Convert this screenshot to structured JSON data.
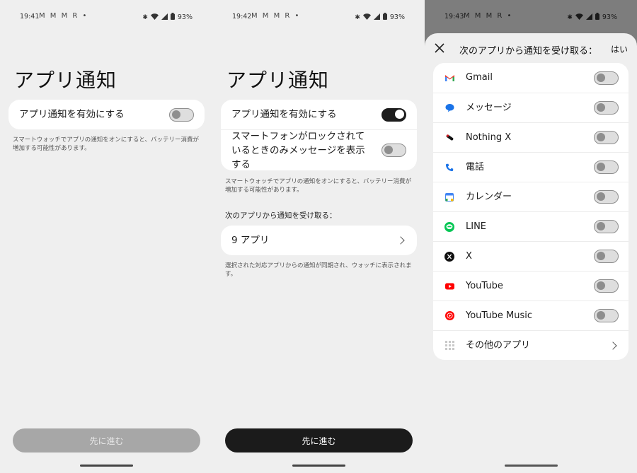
{
  "screen1": {
    "status": {
      "time": "19:41",
      "notifs": "M M M R •",
      "battery": "93%"
    },
    "title": "アプリ通知",
    "toggle_label": "アプリ通知を有効にする",
    "toggle_on": false,
    "note": "スマートウォッチでアプリの通知をオンにすると、バッテリー消費が増加する可能性があります。",
    "cta": "先に進む"
  },
  "screen2": {
    "status": {
      "time": "19:42",
      "notifs": "M M M R •",
      "battery": "93%"
    },
    "title": "アプリ通知",
    "toggle_label": "アプリ通知を有効にする",
    "toggle_on": true,
    "lock_label": "スマートフォンがロックされているときのみメッセージを表示する",
    "lock_on": false,
    "note": "スマートウォッチでアプリの通知をオンにすると、バッテリー消費が増加する可能性があります。",
    "apps_heading": "次のアプリから通知を受け取る：",
    "apps_count": "9 アプリ",
    "apps_note": "選択された対応アプリからの通知が同期され、ウォッチに表示されます。",
    "cta": "先に進む"
  },
  "screen3": {
    "status": {
      "time": "19:43",
      "notifs": "M M M R •",
      "battery": "93%"
    },
    "sheet_title": "次のアプリから通知を受け取る：",
    "confirm": "はい",
    "apps": [
      {
        "name": "Gmail",
        "icon": "gmail-icon",
        "on": false
      },
      {
        "name": "メッセージ",
        "icon": "messages-icon",
        "on": false
      },
      {
        "name": "Nothing X",
        "icon": "nothing-x-icon",
        "on": false
      },
      {
        "name": "電話",
        "icon": "phone-icon",
        "on": false
      },
      {
        "name": "カレンダー",
        "icon": "calendar-icon",
        "on": false
      },
      {
        "name": "LINE",
        "icon": "line-icon",
        "on": false
      },
      {
        "name": "X",
        "icon": "x-icon",
        "on": false
      },
      {
        "name": "YouTube",
        "icon": "youtube-icon",
        "on": false
      },
      {
        "name": "YouTube Music",
        "icon": "youtube-music-icon",
        "on": false
      }
    ],
    "other_apps": "その他のアプリ"
  },
  "colors": {
    "toggle_on": "#1d1d1d",
    "cta_enabled": "#1b1b1b",
    "cta_disabled": "#a7a7a7",
    "youtube": "#ff0000",
    "line": "#06c755"
  }
}
